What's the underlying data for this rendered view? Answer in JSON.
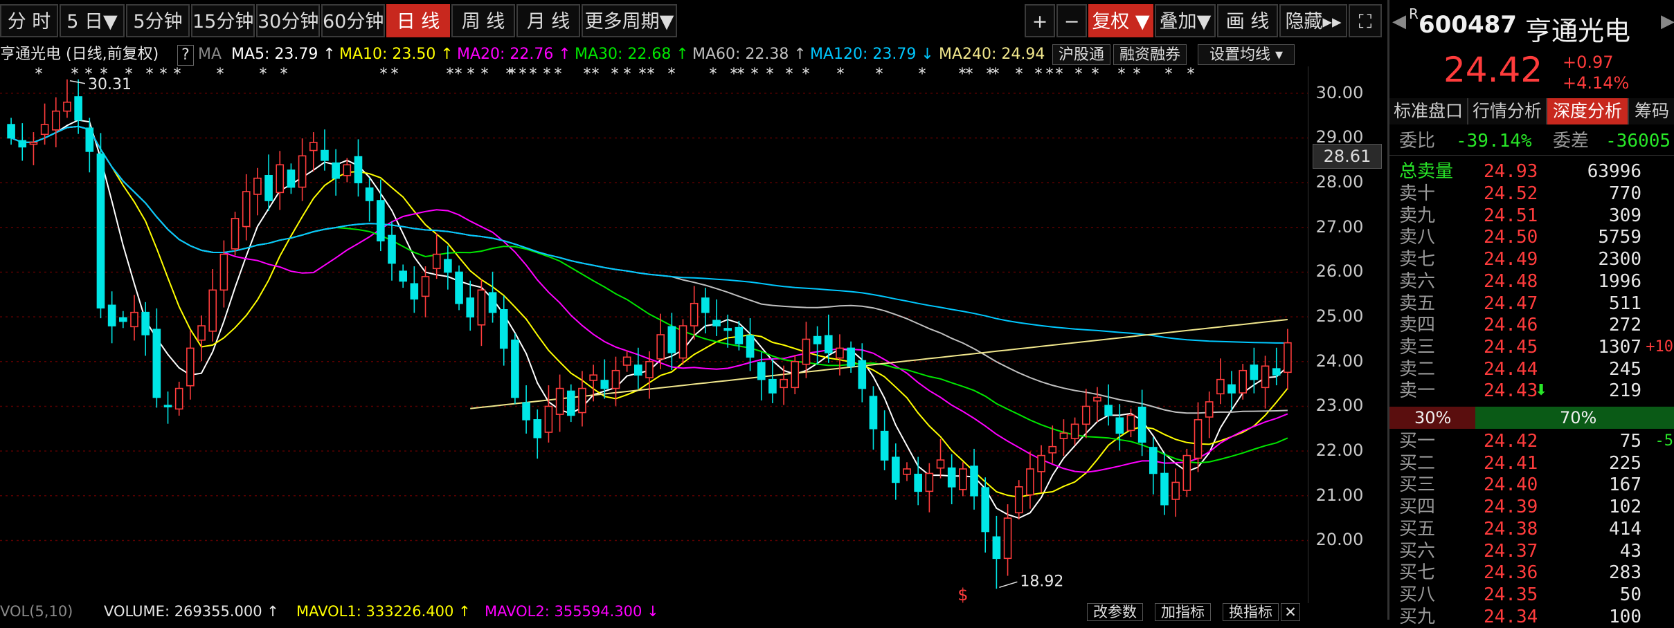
{
  "toolbar": {
    "left_buttons": [
      "分 时",
      "5 日▼",
      "5分钟",
      "15分钟",
      "30分钟",
      "60分钟",
      "日 线",
      "周 线",
      "月 线",
      "更多周期▼"
    ],
    "right_buttons": [
      "+",
      "−",
      "复权 ▼",
      "叠加▼",
      "画 线",
      "隐藏▸▸",
      "⛶"
    ],
    "active_period": "日 线"
  },
  "legend": {
    "title": "亨通光电 (日线,前复权)",
    "help": "?",
    "ma_label": "MA",
    "ma5": "MA5: 23.79 ↑",
    "ma10": "MA10: 23.50 ↑",
    "ma20": "MA20: 22.76 ↑",
    "ma30": "MA30: 22.68 ↑",
    "ma60": "MA60: 22.38 ↑",
    "ma120": "MA120: 23.79 ↓",
    "ma240": "MA240: 24.94 ↑",
    "btn1": "沪股通",
    "btn2": "融资融券",
    "btn3": "设置均线 ▾"
  },
  "colors": {
    "up": "#ff3c3c",
    "down": "#00e6e6",
    "ma5": "#ffffff",
    "ma10": "#ffff00",
    "ma20": "#ff00ff",
    "ma30": "#00e600",
    "ma60": "#c0c0c0",
    "ma120": "#00c8ff",
    "ma240": "#f0e68c"
  },
  "chart": {
    "high_label": "30.31",
    "low_label": "18.92",
    "current_price_tag": "28.61",
    "signal_marker": "$",
    "y_ticks": [
      "30.00",
      "29.00",
      "28.00",
      "27.00",
      "26.00",
      "25.00",
      "24.00",
      "23.00",
      "22.00",
      "21.00",
      "20.00"
    ]
  },
  "chart_data": {
    "type": "candlestick",
    "ylim": [
      18.6,
      30.6
    ],
    "y_ticks": [
      30,
      29,
      28,
      27,
      26,
      25,
      24,
      23,
      22,
      21,
      20
    ],
    "high": 30.31,
    "low": 18.92,
    "ma_last": {
      "MA5": 23.79,
      "MA10": 23.5,
      "MA20": 22.76,
      "MA30": 22.68,
      "MA60": 22.38,
      "MA120": 23.79,
      "MA240": 24.94
    },
    "closes": [
      29.0,
      28.8,
      28.9,
      29.3,
      29.6,
      29.8,
      29.4,
      28.7,
      25.2,
      24.8,
      24.9,
      25.1,
      24.6,
      23.2,
      23.0,
      23.4,
      24.3,
      24.8,
      25.6,
      26.4,
      27.2,
      27.8,
      28.1,
      27.6,
      28.4,
      27.9,
      28.6,
      28.9,
      28.5,
      28.1,
      28.4,
      28.0,
      27.6,
      26.7,
      26.2,
      25.8,
      25.4,
      25.9,
      26.4,
      26.0,
      25.3,
      25.0,
      25.6,
      25.1,
      24.3,
      23.2,
      22.7,
      22.3,
      23.0,
      23.4,
      22.8,
      23.4,
      23.7,
      23.4,
      23.8,
      24.1,
      23.7,
      24.0,
      24.6,
      24.2,
      24.8,
      25.3,
      25.1,
      24.8,
      24.7,
      24.4,
      24.1,
      23.6,
      23.3,
      23.6,
      24.0,
      24.5,
      24.4,
      24.2,
      24.3,
      23.9,
      23.4,
      22.5,
      21.8,
      21.3,
      21.6,
      21.1,
      21.5,
      21.8,
      21.2,
      21.6,
      21.0,
      20.2,
      19.6,
      20.5,
      21.2,
      21.6,
      21.9,
      22.1,
      22.4,
      22.6,
      23.0,
      23.2,
      22.8,
      22.4,
      22.8,
      22.2,
      21.5,
      20.8,
      21.3,
      21.9,
      22.7,
      23.1,
      23.6,
      23.3,
      23.8,
      23.6,
      23.9,
      23.7,
      24.42
    ]
  },
  "bottom": {
    "vol_label": "VOL(5,10)",
    "volume": "VOLUME: 269355.000 ↑",
    "mavol1": "MAVOL1: 333226.400 ↑",
    "mavol2": "MAVOL2: 355594.300 ↓",
    "btn1": "改参数",
    "btn2": "加指标",
    "btn3": "换指标"
  },
  "quote": {
    "code_prefix": "R",
    "code": "600487",
    "name": "亨通光电",
    "price": "24.42",
    "change": "+0.97",
    "change_pct": "+4.14%",
    "tabs": [
      "标准盘口",
      "行情分析",
      "深度分析",
      "筹码"
    ],
    "active_tab": "深度分析",
    "weibi_label": "委比",
    "weibi": "-39.14%",
    "weicha_label": "委差",
    "weicha": "-36005",
    "total_label": "总卖量",
    "total_price": "24.93",
    "total_vol": "63996",
    "sells": [
      {
        "label": "卖十",
        "price": "24.52",
        "vol": "770",
        "chg": ""
      },
      {
        "label": "卖九",
        "price": "24.51",
        "vol": "309",
        "chg": ""
      },
      {
        "label": "卖八",
        "price": "24.50",
        "vol": "5759",
        "chg": ""
      },
      {
        "label": "卖七",
        "price": "24.49",
        "vol": "2300",
        "chg": ""
      },
      {
        "label": "卖六",
        "price": "24.48",
        "vol": "1996",
        "chg": ""
      },
      {
        "label": "卖五",
        "price": "24.47",
        "vol": "511",
        "chg": ""
      },
      {
        "label": "卖四",
        "price": "24.46",
        "vol": "272",
        "chg": ""
      },
      {
        "label": "卖三",
        "price": "24.45",
        "vol": "1307",
        "chg": "+10"
      },
      {
        "label": "卖二",
        "price": "24.44",
        "vol": "245",
        "chg": ""
      },
      {
        "label": "卖一",
        "price": "24.43",
        "vol": "219",
        "chg": "",
        "arrow": "⬇"
      }
    ],
    "ratio_left": "30%",
    "ratio_right": "70%",
    "buy_ratio": 0.3,
    "buys": [
      {
        "label": "买一",
        "price": "24.42",
        "vol": "75",
        "chg": "-5"
      },
      {
        "label": "买二",
        "price": "24.41",
        "vol": "225",
        "chg": ""
      },
      {
        "label": "买三",
        "price": "24.40",
        "vol": "167",
        "chg": ""
      },
      {
        "label": "买四",
        "price": "24.39",
        "vol": "102",
        "chg": ""
      },
      {
        "label": "买五",
        "price": "24.38",
        "vol": "414",
        "chg": ""
      },
      {
        "label": "买六",
        "price": "24.37",
        "vol": "43",
        "chg": ""
      },
      {
        "label": "买七",
        "price": "24.36",
        "vol": "283",
        "chg": ""
      },
      {
        "label": "买八",
        "price": "24.35",
        "vol": "50",
        "chg": ""
      },
      {
        "label": "买九",
        "price": "24.34",
        "vol": "100",
        "chg": ""
      }
    ]
  }
}
